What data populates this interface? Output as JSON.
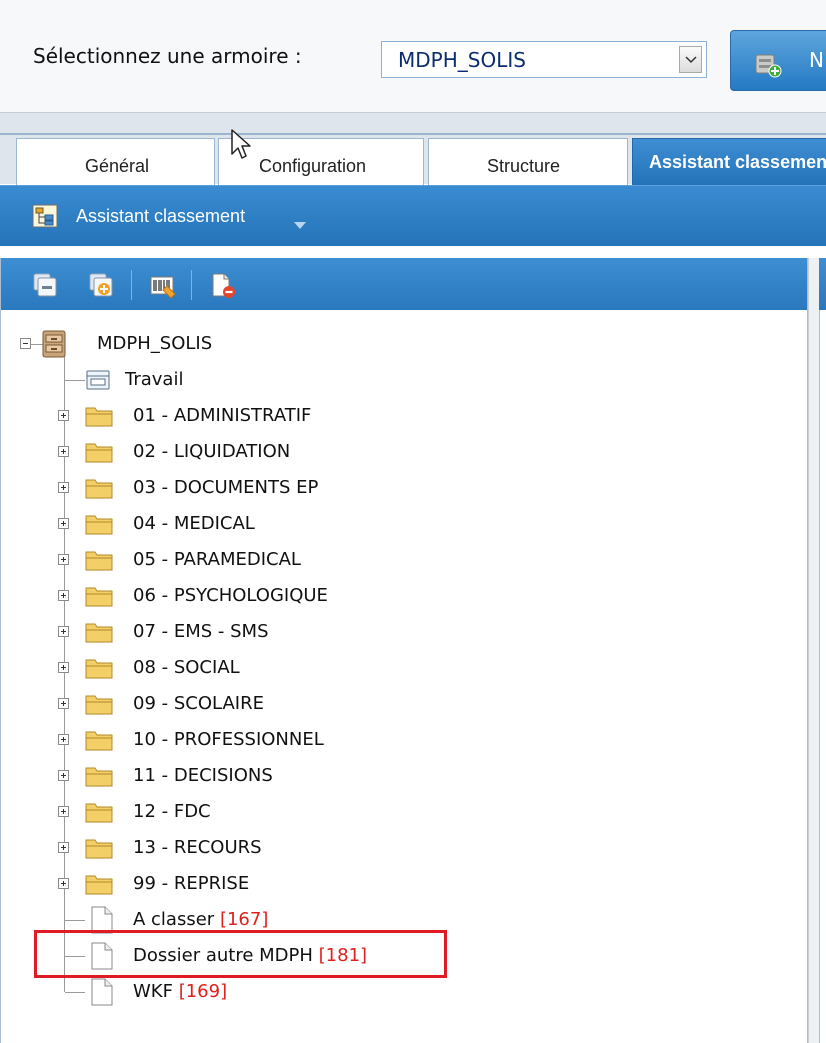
{
  "selector": {
    "label": "Sélectionnez une armoire :",
    "value": "MDPH_SOLIS",
    "new_button_label": "N"
  },
  "tabs": [
    {
      "label": "Général",
      "active": false
    },
    {
      "label": "Configuration",
      "active": false
    },
    {
      "label": "Structure",
      "active": false
    },
    {
      "label": "Assistant classement",
      "active": true
    }
  ],
  "section": {
    "title": "Assistant classement"
  },
  "toolbar": {
    "buttons": [
      "collapse-all-icon",
      "expand-all-icon",
      "barcode-icon",
      "delete-document-icon"
    ]
  },
  "tree": {
    "root": {
      "label": "MDPH_SOLIS",
      "icon": "cabinet-icon"
    },
    "workspace": {
      "label": "Travail",
      "icon": "work-folder-icon"
    },
    "folders": [
      {
        "label": "01 - ADMINISTRATIF"
      },
      {
        "label": "02 - LIQUIDATION"
      },
      {
        "label": "03 - DOCUMENTS EP"
      },
      {
        "label": "04 - MEDICAL"
      },
      {
        "label": "05 - PARAMEDICAL"
      },
      {
        "label": "06 - PSYCHOLOGIQUE"
      },
      {
        "label": "07 - EMS - SMS"
      },
      {
        "label": "08 - SOCIAL"
      },
      {
        "label": "09 - SCOLAIRE"
      },
      {
        "label": "10 - PROFESSIONNEL"
      },
      {
        "label": "11 - DECISIONS"
      },
      {
        "label": "12 - FDC"
      },
      {
        "label": "13 - RECOURS"
      },
      {
        "label": "99 - REPRISE"
      }
    ],
    "documents": [
      {
        "label": "A classer",
        "count": "[167]"
      },
      {
        "label": "Dossier autre MDPH",
        "count": "[181]"
      },
      {
        "label": "WKF",
        "count": "[169]"
      }
    ]
  },
  "colors": {
    "accent": "#2a78bd",
    "count": "#e0201d",
    "highlight": "#e01b24"
  }
}
